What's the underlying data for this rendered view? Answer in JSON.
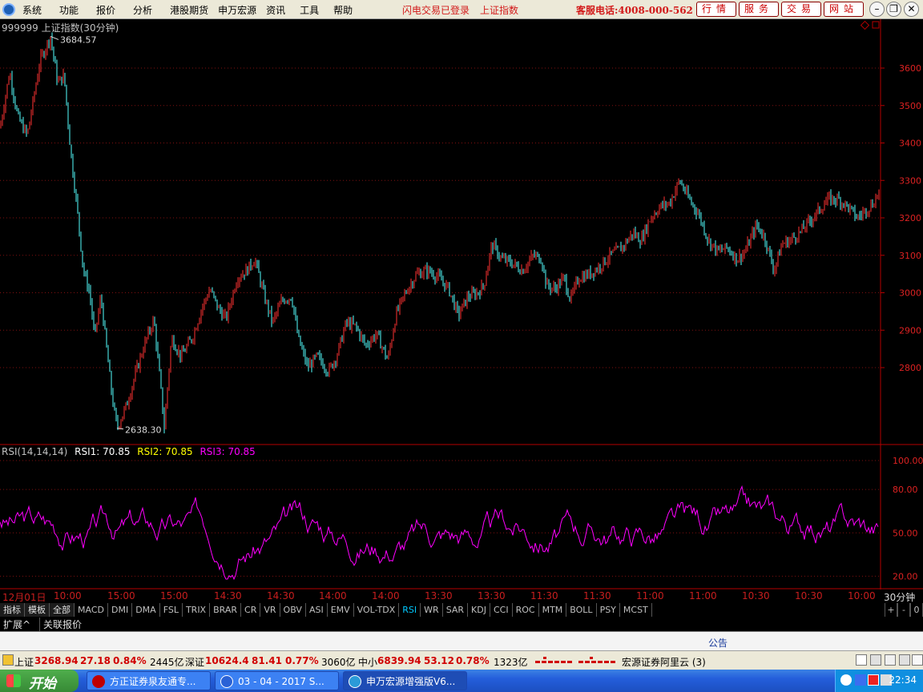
{
  "menubar": {
    "items": [
      "系统",
      "功能",
      "报价",
      "分析",
      "港股期货",
      "申万宏源",
      "资讯",
      "工具",
      "帮助"
    ],
    "flash_status": "闪电交易已登录",
    "index_name": "上证指数",
    "service_phone": "客服电话:4008-000-562",
    "right_buttons": [
      "行情",
      "服务",
      "交易",
      "网站"
    ]
  },
  "chart": {
    "symbol_title": "999999 上证指数(30分钟)",
    "high_label": "3684.57",
    "low_label": "2638.30",
    "y_ticks": [
      3600,
      3500,
      3400,
      3300,
      3200,
      3100,
      3000,
      2900,
      2800
    ],
    "colors": {
      "up": "#ff3232",
      "down": "#54ffff",
      "axis": "#b40000",
      "grid": "#801010",
      "rsi": "#ff00ff"
    }
  },
  "rsi": {
    "title": "RSI(14,14,14)",
    "rsi1": "RSI1: 70.85",
    "rsi2": "RSI2: 70.85",
    "rsi3": "RSI3: 70.85",
    "y_ticks": [
      "100.00",
      "80.00",
      "50.00",
      "20.00"
    ]
  },
  "time_axis": {
    "labels": [
      "12月01日",
      "10:00",
      "15:00",
      "15:00",
      "14:30",
      "14:30",
      "14:00",
      "14:00",
      "13:30",
      "13:30",
      "11:30",
      "11:30",
      "11:00",
      "11:00",
      "10:30",
      "10:30",
      "10:00"
    ],
    "period": "30分钟"
  },
  "tabs": {
    "zh": [
      "指标",
      "模板",
      "全部"
    ],
    "indicators": [
      "MACD",
      "DMI",
      "DMA",
      "FSL",
      "TRIX",
      "BRAR",
      "CR",
      "VR",
      "OBV",
      "ASI",
      "EMV",
      "VOL-TDX",
      "RSI",
      "WR",
      "SAR",
      "KDJ",
      "CCI",
      "ROC",
      "MTM",
      "BOLL",
      "PSY",
      "MCST"
    ],
    "active": "RSI",
    "right": [
      "+",
      "-",
      "0"
    ]
  },
  "ext": {
    "expand": "扩展^",
    "related": "关联报价"
  },
  "notice": {
    "label": "公告"
  },
  "status": {
    "sh_name": "上证",
    "sh_value": "3268.94",
    "sh_change": "27.18",
    "sh_pct": "0.84%",
    "sh_amount": "2445亿",
    "sz_name": "深证",
    "sz_value": "10624.4",
    "sz_change": "81.41",
    "sz_pct": "0.77%",
    "sz_amount": "3060亿",
    "zx_name": "中小",
    "zx_value": "6839.94",
    "zx_change": "53.12",
    "zx_pct": "0.78%",
    "zx_amount": "1323亿",
    "server": "宏源证券阿里云 (3)"
  },
  "taskbar": {
    "start": "开始",
    "tasks": [
      "方正证券泉友通专...",
      "03 - 04 - 2017 S...",
      "申万宏源增强版V6..."
    ],
    "clock": "22:34"
  }
}
